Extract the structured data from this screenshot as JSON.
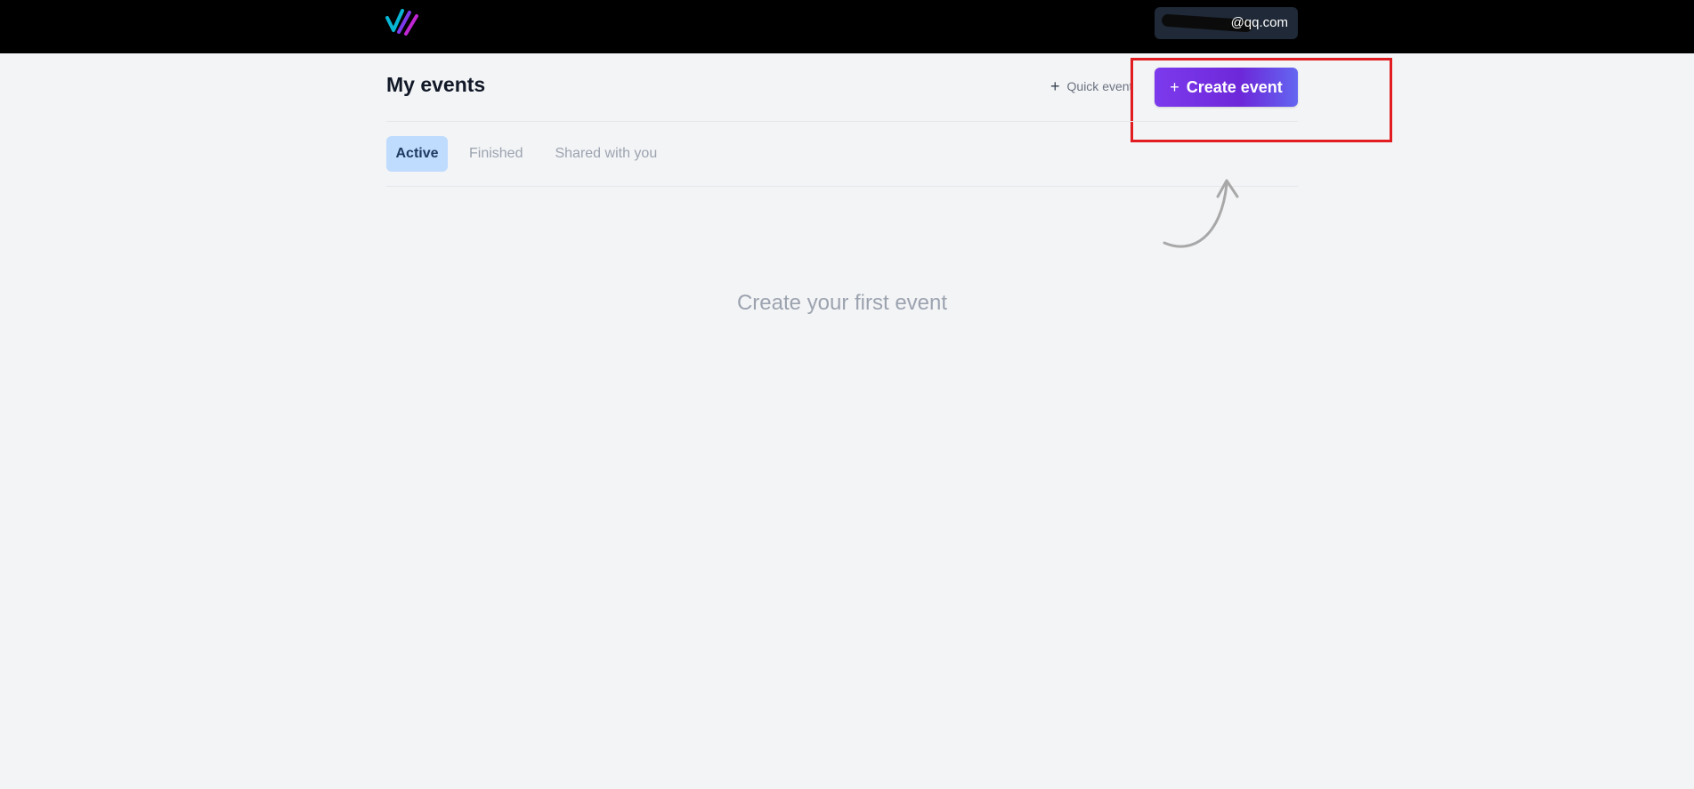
{
  "header": {
    "logo_icon": "stripes-logo-icon",
    "user_email": "@qq.com",
    "colors": {
      "background": "#000000",
      "pill": "#1f2937",
      "logo_cyan": "#06b6d4",
      "logo_purple": "#7c3aed",
      "logo_magenta": "#c026d3"
    }
  },
  "page": {
    "title": "My events"
  },
  "actions": {
    "quick_event_label": "Quick event",
    "create_event_label": "Create event",
    "plus_icon": "plus-icon",
    "accent": "#7c3aed",
    "highlight_color": "#e11d22"
  },
  "tabs": [
    {
      "label": "Active",
      "active": true
    },
    {
      "label": "Finished",
      "active": false
    },
    {
      "label": "Shared with you",
      "active": false
    }
  ],
  "empty_state": {
    "message": "Create your first event",
    "arrow_icon": "curved-arrow-icon"
  }
}
